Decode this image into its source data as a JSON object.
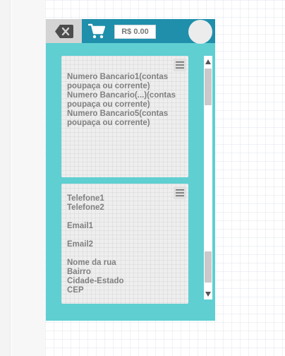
{
  "topbar": {
    "cart_icon": "shopping-cart-icon",
    "back_icon": "backspace-icon",
    "price": "R$ 0.00",
    "colors": {
      "bar": "#1f8fab",
      "background": "#5fcfd2"
    }
  },
  "bank_panel": {
    "menu_icon": "menu-icon",
    "lines": [
      "Numero Bancario1(contas poupaça ou corrente)",
      "Numero Bancario(...)(contas poupaça ou corrente)",
      "Numero Bancario5(contas poupaça ou corrente)"
    ]
  },
  "contact_panel": {
    "menu_icon": "menu-icon",
    "phone1": "Telefone1",
    "phone2": "Telefone2",
    "email1": "Email1",
    "email2": "Email2",
    "street": "Nome da rua",
    "district": "Bairro",
    "city_state": "Cidade-Estado",
    "zip": "CEP"
  }
}
